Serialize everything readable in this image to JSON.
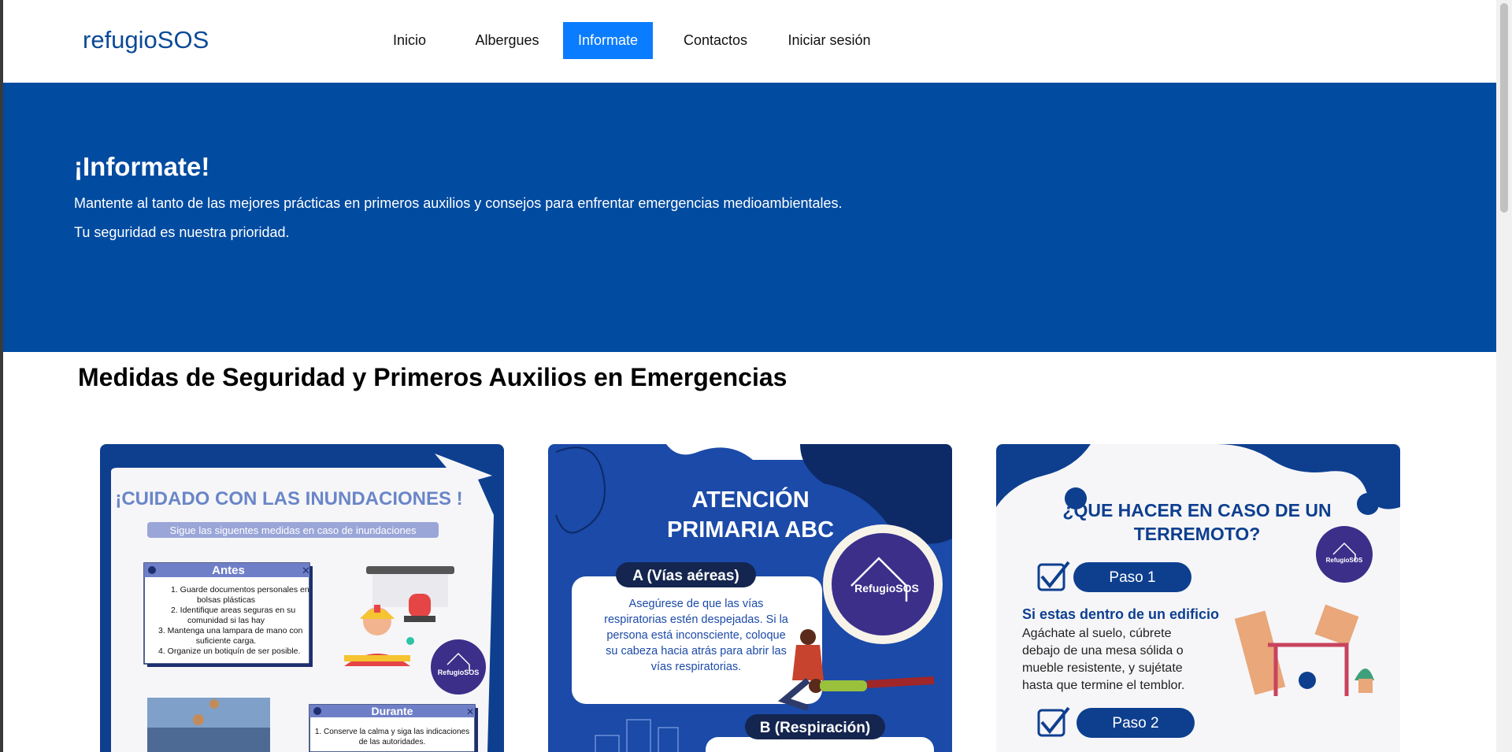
{
  "brand": "refugioSOS",
  "nav": {
    "items": [
      "Inicio",
      "Albergues",
      "Informate",
      "Contactos",
      "Iniciar sesión"
    ],
    "active": "Informate"
  },
  "hero": {
    "title": "¡Informate!",
    "line1": "Mantente al tanto de las mejores prácticas en primeros auxilios y consejos para enfrentar emergencias medioambientales.",
    "line2": "Tu seguridad es nuestra prioridad."
  },
  "section_title": "Medidas de Seguridad y Primeros Auxilios en Emergencias",
  "cards": {
    "flood": {
      "title": "¡CUIDADO CON LAS INUNDACIONES !",
      "subtitle": "Sigue las siguentes medidas en caso de inundaciones",
      "antes_label": "Antes",
      "antes_items": [
        "1.    Guarde documentos personales en",
        "bolsas plásticas",
        "2.    Identifique areas seguras en su",
        "comunidad si las hay",
        "3.   Mantenga una lampara de mano con",
        "suficiente carga.",
        "4.   Organize un botiquín de ser posible."
      ],
      "durante_label": "Durante",
      "durante_items": [
        "1. Conserve la calma y siga las indicaciones",
        "de las autoridades."
      ],
      "logo": "RefugioSOS"
    },
    "abc": {
      "title_line1": "ATENCIÓN",
      "title_line2": "PRIMARIA ABC",
      "a_label": "A (Vías aéreas)",
      "a_text": [
        "Asegúrese de que las vías",
        "respiratorias estén despejadas. Si la",
        "persona está inconsciente, coloque",
        "su cabeza hacia atrás para abrir las",
        "vías respiratorias."
      ],
      "b_label": "B (Respiración)",
      "logo": "RefugioSOS"
    },
    "quake": {
      "title_line1": "¿QUE HACER EN CASO DE UN",
      "title_line2": "TERREMOTO?",
      "paso1": "Paso 1",
      "paso1_head": "Si estas dentro de un edificio",
      "paso1_text": [
        "Agáchate al suelo, cúbrete",
        "debajo de una mesa sólida o",
        "mueble resistente, y sujétate",
        "hasta que termine el temblor."
      ],
      "paso2": "Paso 2",
      "logo": "RefugioSOS"
    }
  }
}
